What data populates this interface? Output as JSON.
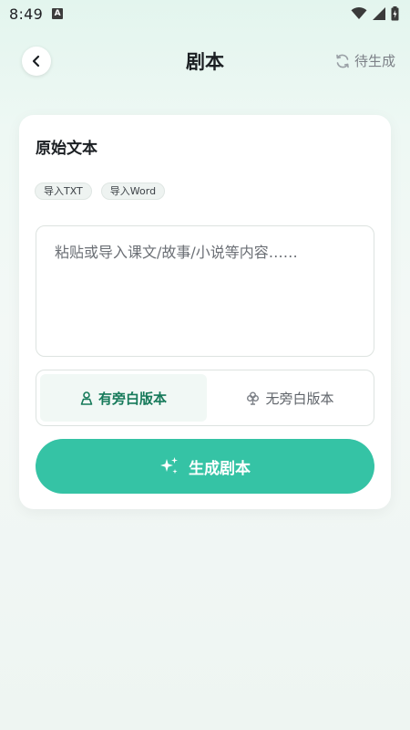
{
  "status_bar": {
    "time": "8:49",
    "notification_icon_letter": "A",
    "icons": [
      "wifi-icon",
      "signal-icon",
      "battery-icon"
    ]
  },
  "header": {
    "title": "剧本",
    "back_icon": "chevron-left-icon",
    "status_label": "待生成",
    "status_icon": "refresh-icon"
  },
  "card": {
    "section_title": "原始文本",
    "import_buttons": [
      {
        "label": "导入TXT"
      },
      {
        "label": "导入Word"
      }
    ],
    "text_input": {
      "value": "",
      "placeholder": "粘贴或导入课文/故事/小说等内容……"
    },
    "modes": [
      {
        "label": "有旁白版本",
        "icon": "person-icon",
        "selected": true
      },
      {
        "label": "无旁白版本",
        "icon": "spade-icon",
        "selected": false
      }
    ],
    "generate_button": {
      "label": "生成剧本",
      "icon": "sparkle-icon"
    }
  },
  "colors": {
    "accent": "#35c3a5",
    "selected_text": "#167a5a",
    "background": "#eef8f4"
  }
}
